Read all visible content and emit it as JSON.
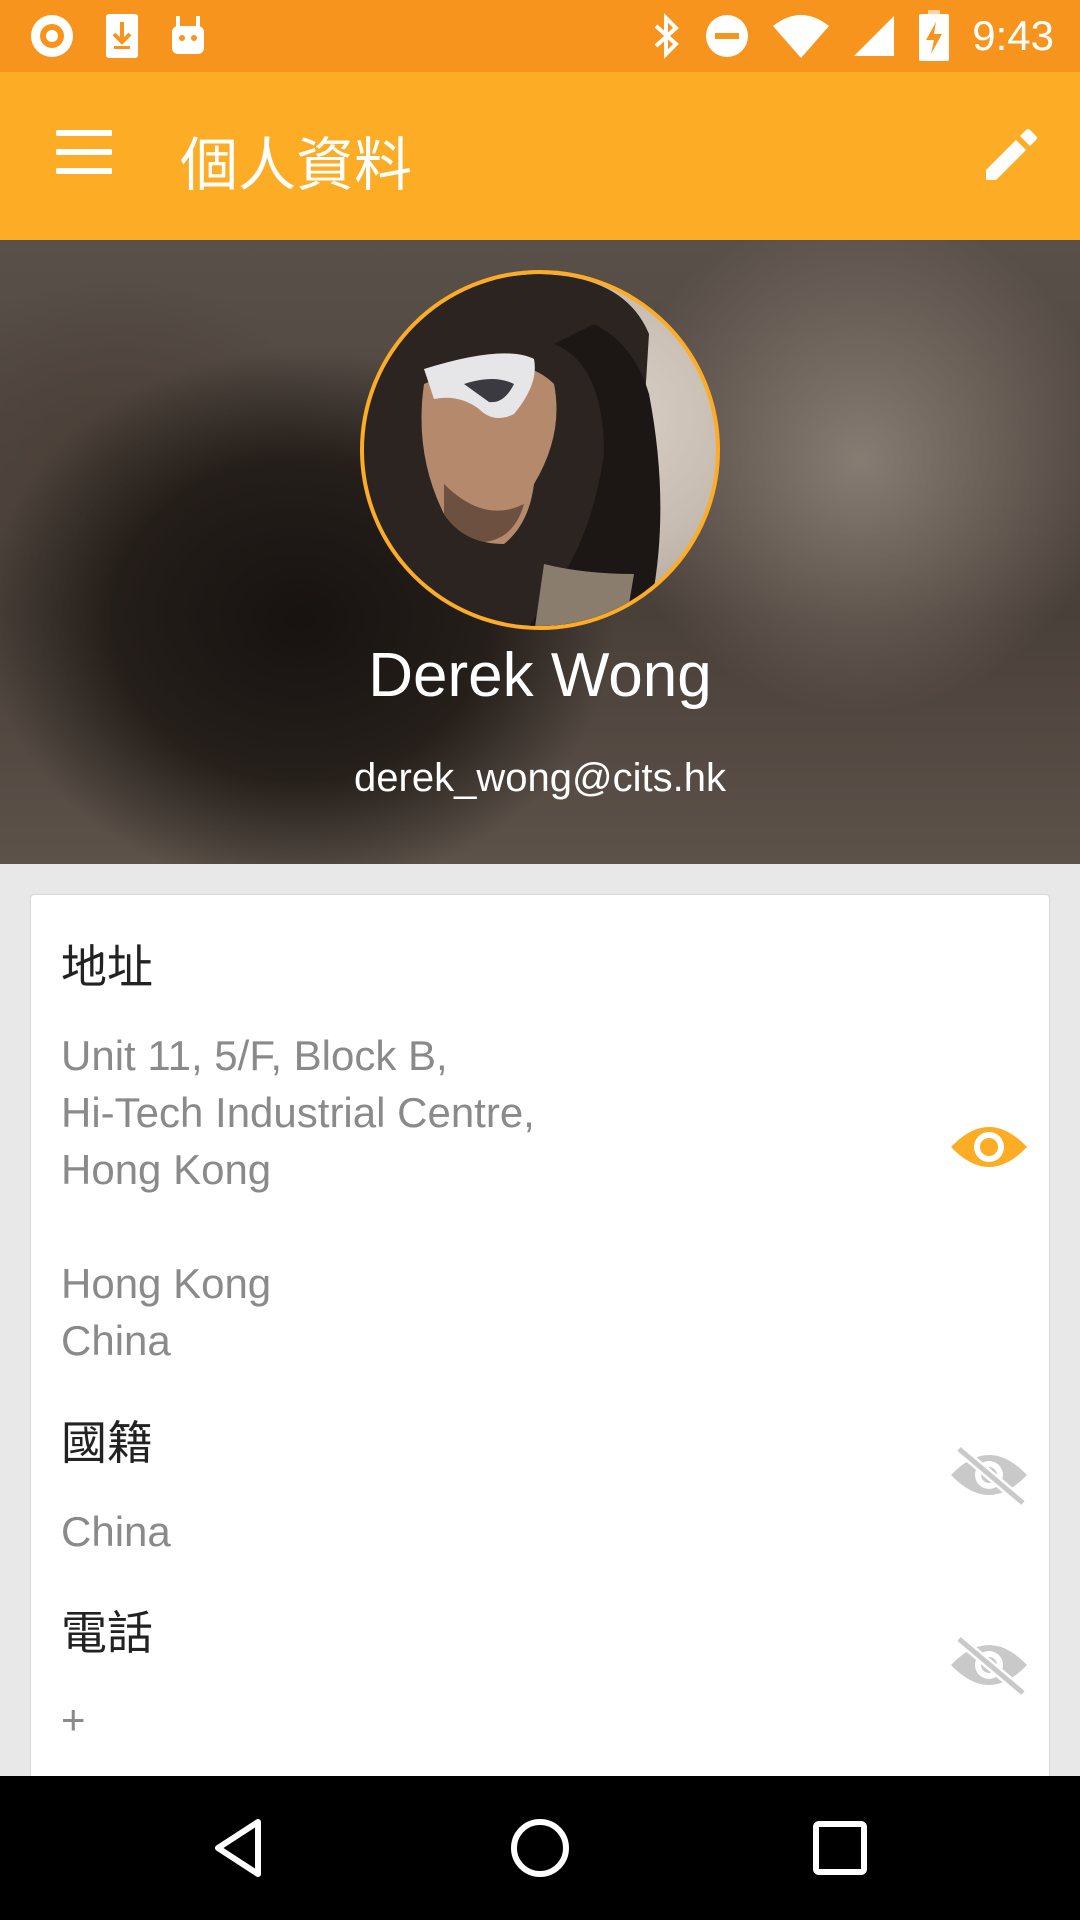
{
  "status_bar": {
    "time": "9:43",
    "left_icons": [
      "app-notification-icon",
      "download-icon",
      "android-icon"
    ],
    "right_icons": [
      "bluetooth-icon",
      "do-not-disturb-icon",
      "wifi-icon",
      "cell-signal-icon",
      "battery-charging-icon"
    ]
  },
  "app_bar": {
    "title": "個人資料",
    "menu_icon": "hamburger-menu-icon",
    "edit_icon": "edit-pencil-icon"
  },
  "profile": {
    "name": "Derek Wong",
    "email": "derek_wong@cits.hk"
  },
  "sections": {
    "address": {
      "title": "地址",
      "line1": "Unit 11, 5/F, Block B,\nHi-Tech Industrial Centre,\nHong Kong",
      "line2": "Hong Kong\nChina",
      "visibility": "visible"
    },
    "nationality": {
      "title": "國籍",
      "value": "China",
      "visibility": "hidden"
    },
    "phone": {
      "title": "電話",
      "value": "+",
      "visibility": "hidden"
    }
  },
  "colors": {
    "status_bar": "#f7941d",
    "app_bar": "#fdac25",
    "eye_visible": "#fdac25",
    "eye_hidden": "#c9c9c9"
  }
}
